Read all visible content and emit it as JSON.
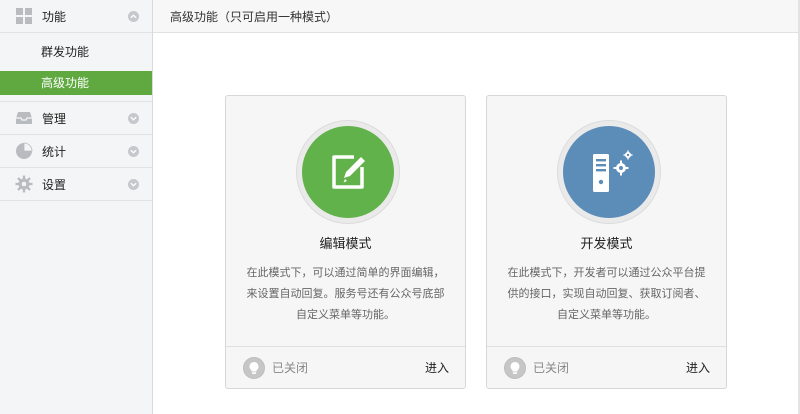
{
  "sidebar": {
    "groups": [
      {
        "label": "功能",
        "icon": "grid-icon",
        "expanded": true
      },
      {
        "label": "管理",
        "icon": "inbox-icon",
        "expanded": false
      },
      {
        "label": "统计",
        "icon": "pie-chart-icon",
        "expanded": false
      },
      {
        "label": "设置",
        "icon": "gear-icon",
        "expanded": false
      }
    ],
    "sub_items": [
      {
        "label": "群发功能",
        "active": false
      },
      {
        "label": "高级功能",
        "active": true
      }
    ]
  },
  "header": {
    "title": "高级功能（只可启用一种模式）"
  },
  "cards": [
    {
      "title": "编辑模式",
      "desc_lines": [
        "在此模式下，可以通过简单的界面编辑，",
        "来设置自动回复。服务号还有公众号底部",
        "自定义菜单等功能。"
      ],
      "status": "已关闭",
      "enter": "进入",
      "icon": "edit-icon",
      "color": "#62b24b"
    },
    {
      "title": "开发模式",
      "desc_lines": [
        "在此模式下，开发者可以通过公众平台提",
        "供的接口，实现自动回复、获取订阅者、",
        "自定义菜单等功能。"
      ],
      "status": "已关闭",
      "enter": "进入",
      "icon": "server-icon",
      "color": "#5b8db8"
    }
  ],
  "colors": {
    "active": "#5fa940"
  }
}
